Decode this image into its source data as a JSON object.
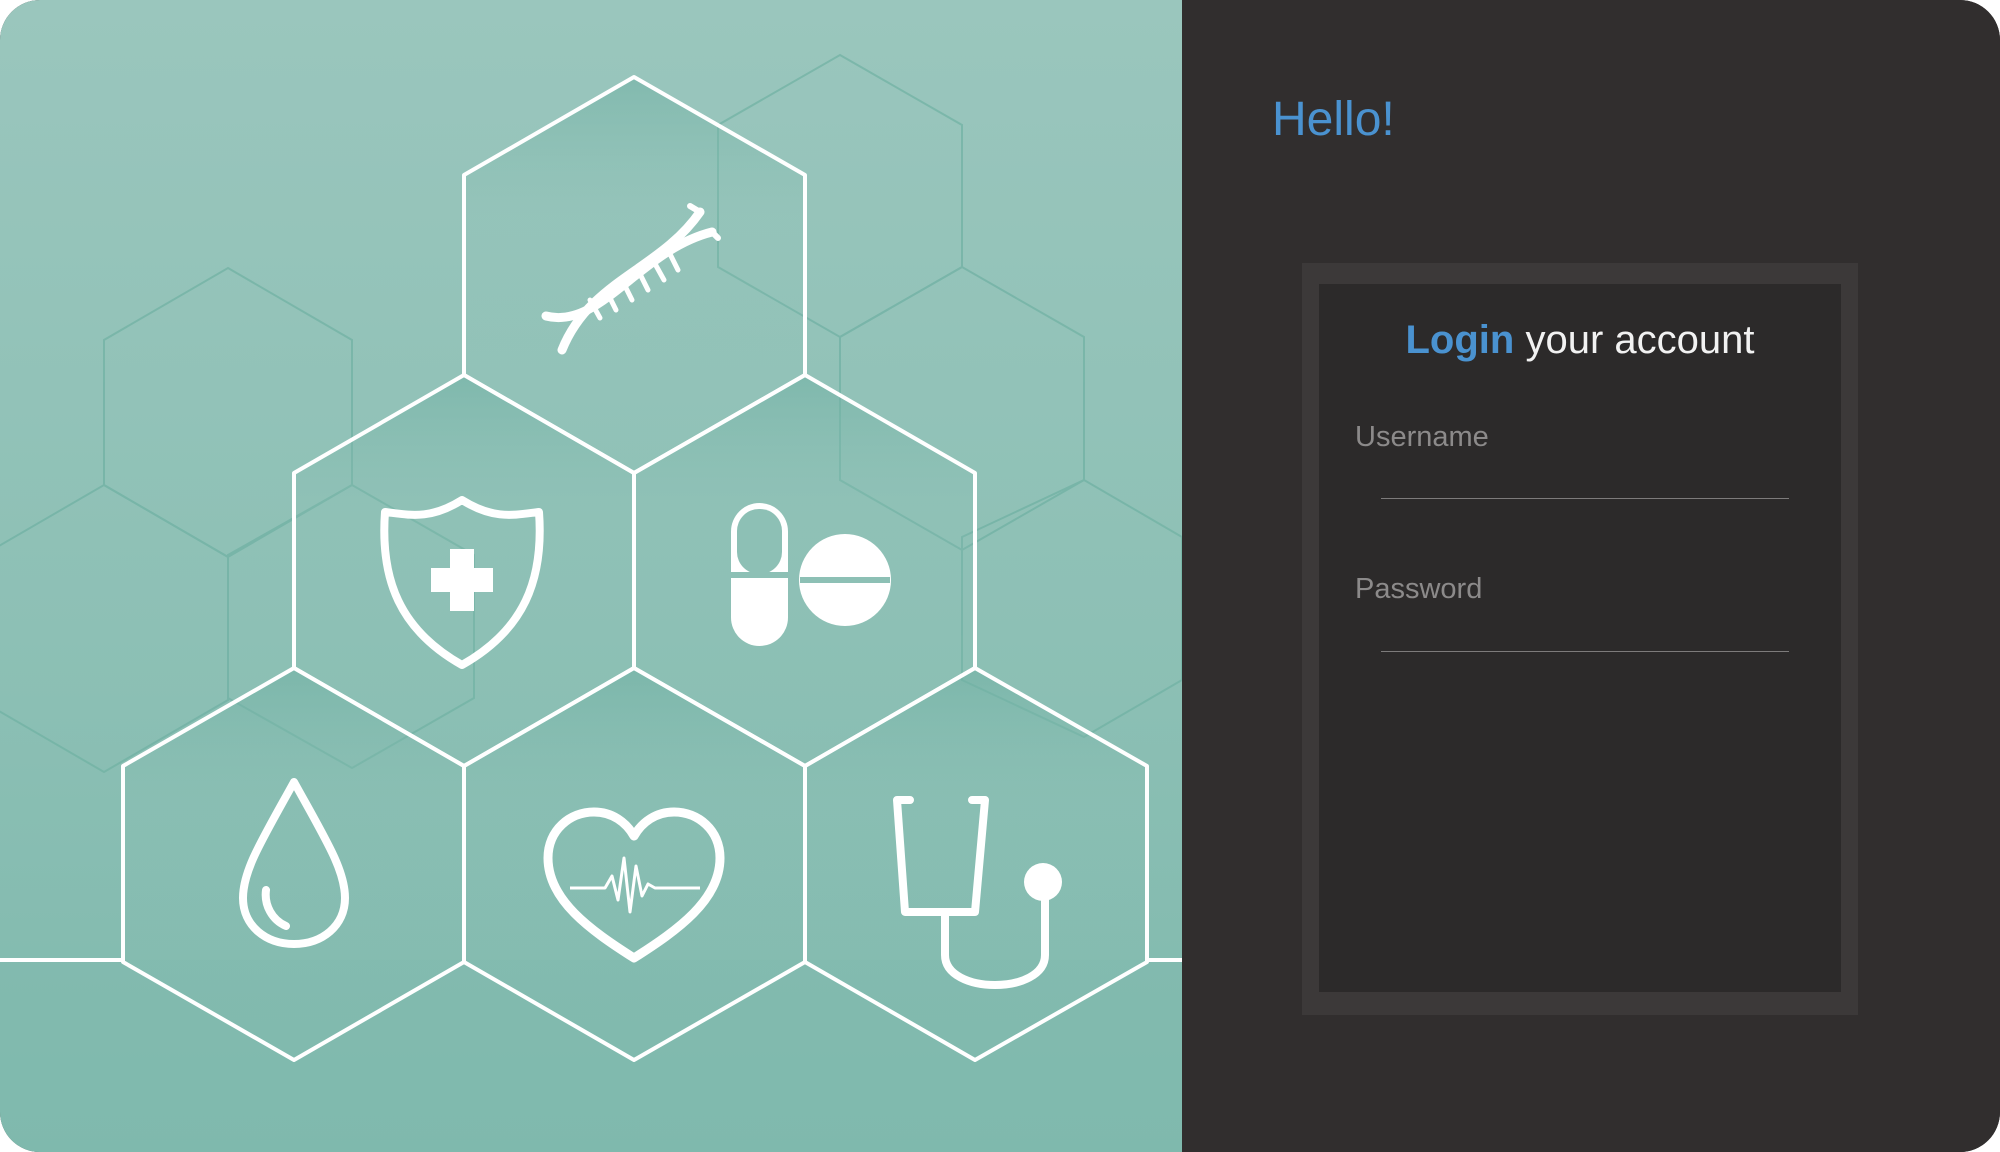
{
  "greeting": "Hello!",
  "login": {
    "title_accent": "Login",
    "title_rest": " your account",
    "username_label": "Username",
    "password_label": "Password",
    "username_value": "",
    "password_value": ""
  },
  "illustration": {
    "icons": [
      "dna-icon",
      "shield-cross-icon",
      "pills-icon",
      "blood-drop-icon",
      "heartbeat-icon",
      "stethoscope-icon"
    ]
  },
  "colors": {
    "accent": "#4a92d0",
    "panel_teal": "#8dc0b5",
    "panel_dark": "#312e2e",
    "card_dark": "#2c2a2a"
  }
}
